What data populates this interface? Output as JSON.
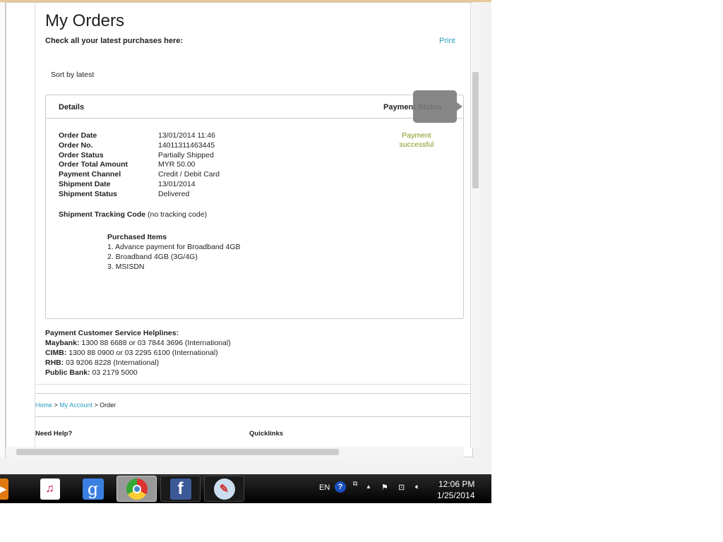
{
  "page": {
    "title": "My Orders",
    "subtitle": "Check all your latest purchases here:",
    "print": "Print",
    "sort": "Sort by latest"
  },
  "card": {
    "details_header": "Details",
    "payment_header": "Payment Status",
    "payment_status": "Payment successful",
    "rows": [
      {
        "k": "Order Date",
        "v": "13/01/2014 11:46"
      },
      {
        "k": "Order No.",
        "v": "14011311463445"
      },
      {
        "k": "Order Status",
        "v": "Partially Shipped"
      },
      {
        "k": "Order Total Amount",
        "v": "MYR 50.00"
      },
      {
        "k": "Payment Channel",
        "v": "Credit / Debit Card"
      },
      {
        "k": "Shipment Date",
        "v": "13/01/2014"
      },
      {
        "k": "Shipment Status",
        "v": "Delivered"
      }
    ],
    "tracking_label": "Shipment Tracking Code",
    "tracking_value": "(no tracking code)",
    "items_title": "Purchased Items",
    "items": [
      "1.  Advance payment for Broadband 4GB",
      "2.  Broadband 4GB (3G/4G)",
      "3.  MSISDN"
    ]
  },
  "helplines": {
    "title": "Payment Customer Service Helplines:",
    "lines": [
      {
        "k": "Maybank:",
        "v": " 1300 88 6688 or 03 7844 3696 (International)"
      },
      {
        "k": "CIMB:",
        "v": " 1300 88 0900 or 03 2295 6100 (International)"
      },
      {
        "k": "RHB:",
        "v": " 03 9206 8228 (International)"
      },
      {
        "k": "Public Bank:",
        "v": " 03 2179 5000"
      }
    ]
  },
  "breadcrumb": {
    "home": "Home",
    "account": "My Account",
    "current": "Order",
    "sep": ">"
  },
  "footer": {
    "help": "Need Help?",
    "quicklinks": "Quicklinks"
  },
  "taskbar": {
    "lang": "EN",
    "time": "12:06 PM",
    "date": "1/25/2014"
  }
}
